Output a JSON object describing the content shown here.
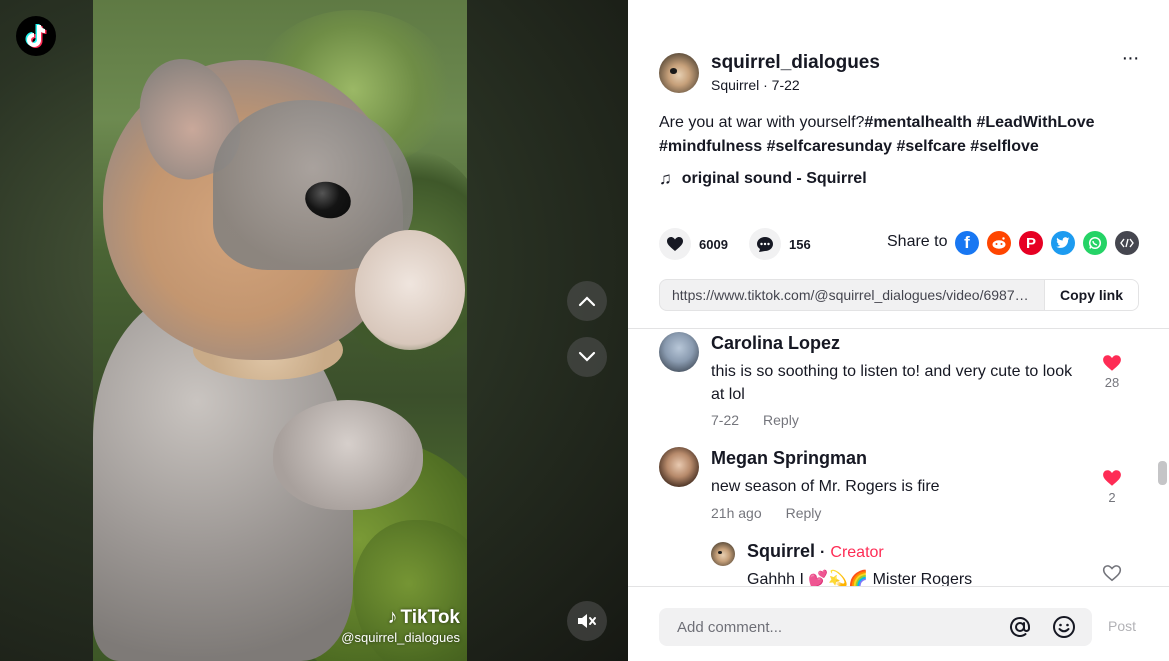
{
  "video": {
    "watermark_brand": "TikTok",
    "watermark_handle": "@squirrel_dialogues",
    "icons": {
      "logo": "tiktok-logo-icon",
      "prev": "chevron-up-icon",
      "next": "chevron-down-icon",
      "mute": "speaker-muted-icon"
    }
  },
  "author": {
    "username": "squirrel_dialogues",
    "subtitle": "Squirrel · 7-22"
  },
  "description": {
    "text": "Are you at war with yourself?",
    "tags": [
      "#mentalhealth",
      "#LeadWithLove",
      "#mindfulness",
      "#selfcaresunday",
      "#selfcare",
      "#selflove"
    ]
  },
  "music": {
    "label": "original sound - Squirrel"
  },
  "stats": {
    "likes": "6009",
    "comments": "156"
  },
  "share": {
    "label": "Share to",
    "targets": [
      "facebook-icon",
      "reddit-icon",
      "pinterest-icon",
      "twitter-icon",
      "whatsapp-icon",
      "embed-icon"
    ],
    "colors": {
      "facebook": "#1877f2",
      "reddit": "#ff4500",
      "pinterest": "#e60023",
      "twitter": "#1d9bf0",
      "whatsapp": "#25d366",
      "embed": "#161823"
    }
  },
  "link": {
    "url": "https://www.tiktok.com/@squirrel_dialogues/video/69878...",
    "copy_label": "Copy link"
  },
  "comments": [
    {
      "name": "Carolina Lopez",
      "text": "this is so soothing to listen to! and very cute to look at lol",
      "date": "7-22",
      "reply": "Reply",
      "likes": "28"
    },
    {
      "name": "Megan Springman",
      "text": "new season of Mr. Rogers is fire",
      "date": "21h ago",
      "reply": "Reply",
      "likes": "2"
    }
  ],
  "reply": {
    "name": "Squirrel",
    "separator": "·",
    "badge": "Creator",
    "text": "Gahhh I 💕💫🌈 Mister Rogers"
  },
  "composer": {
    "placeholder": "Add comment...",
    "post_label": "Post"
  },
  "accent_color": "#fe2c55"
}
